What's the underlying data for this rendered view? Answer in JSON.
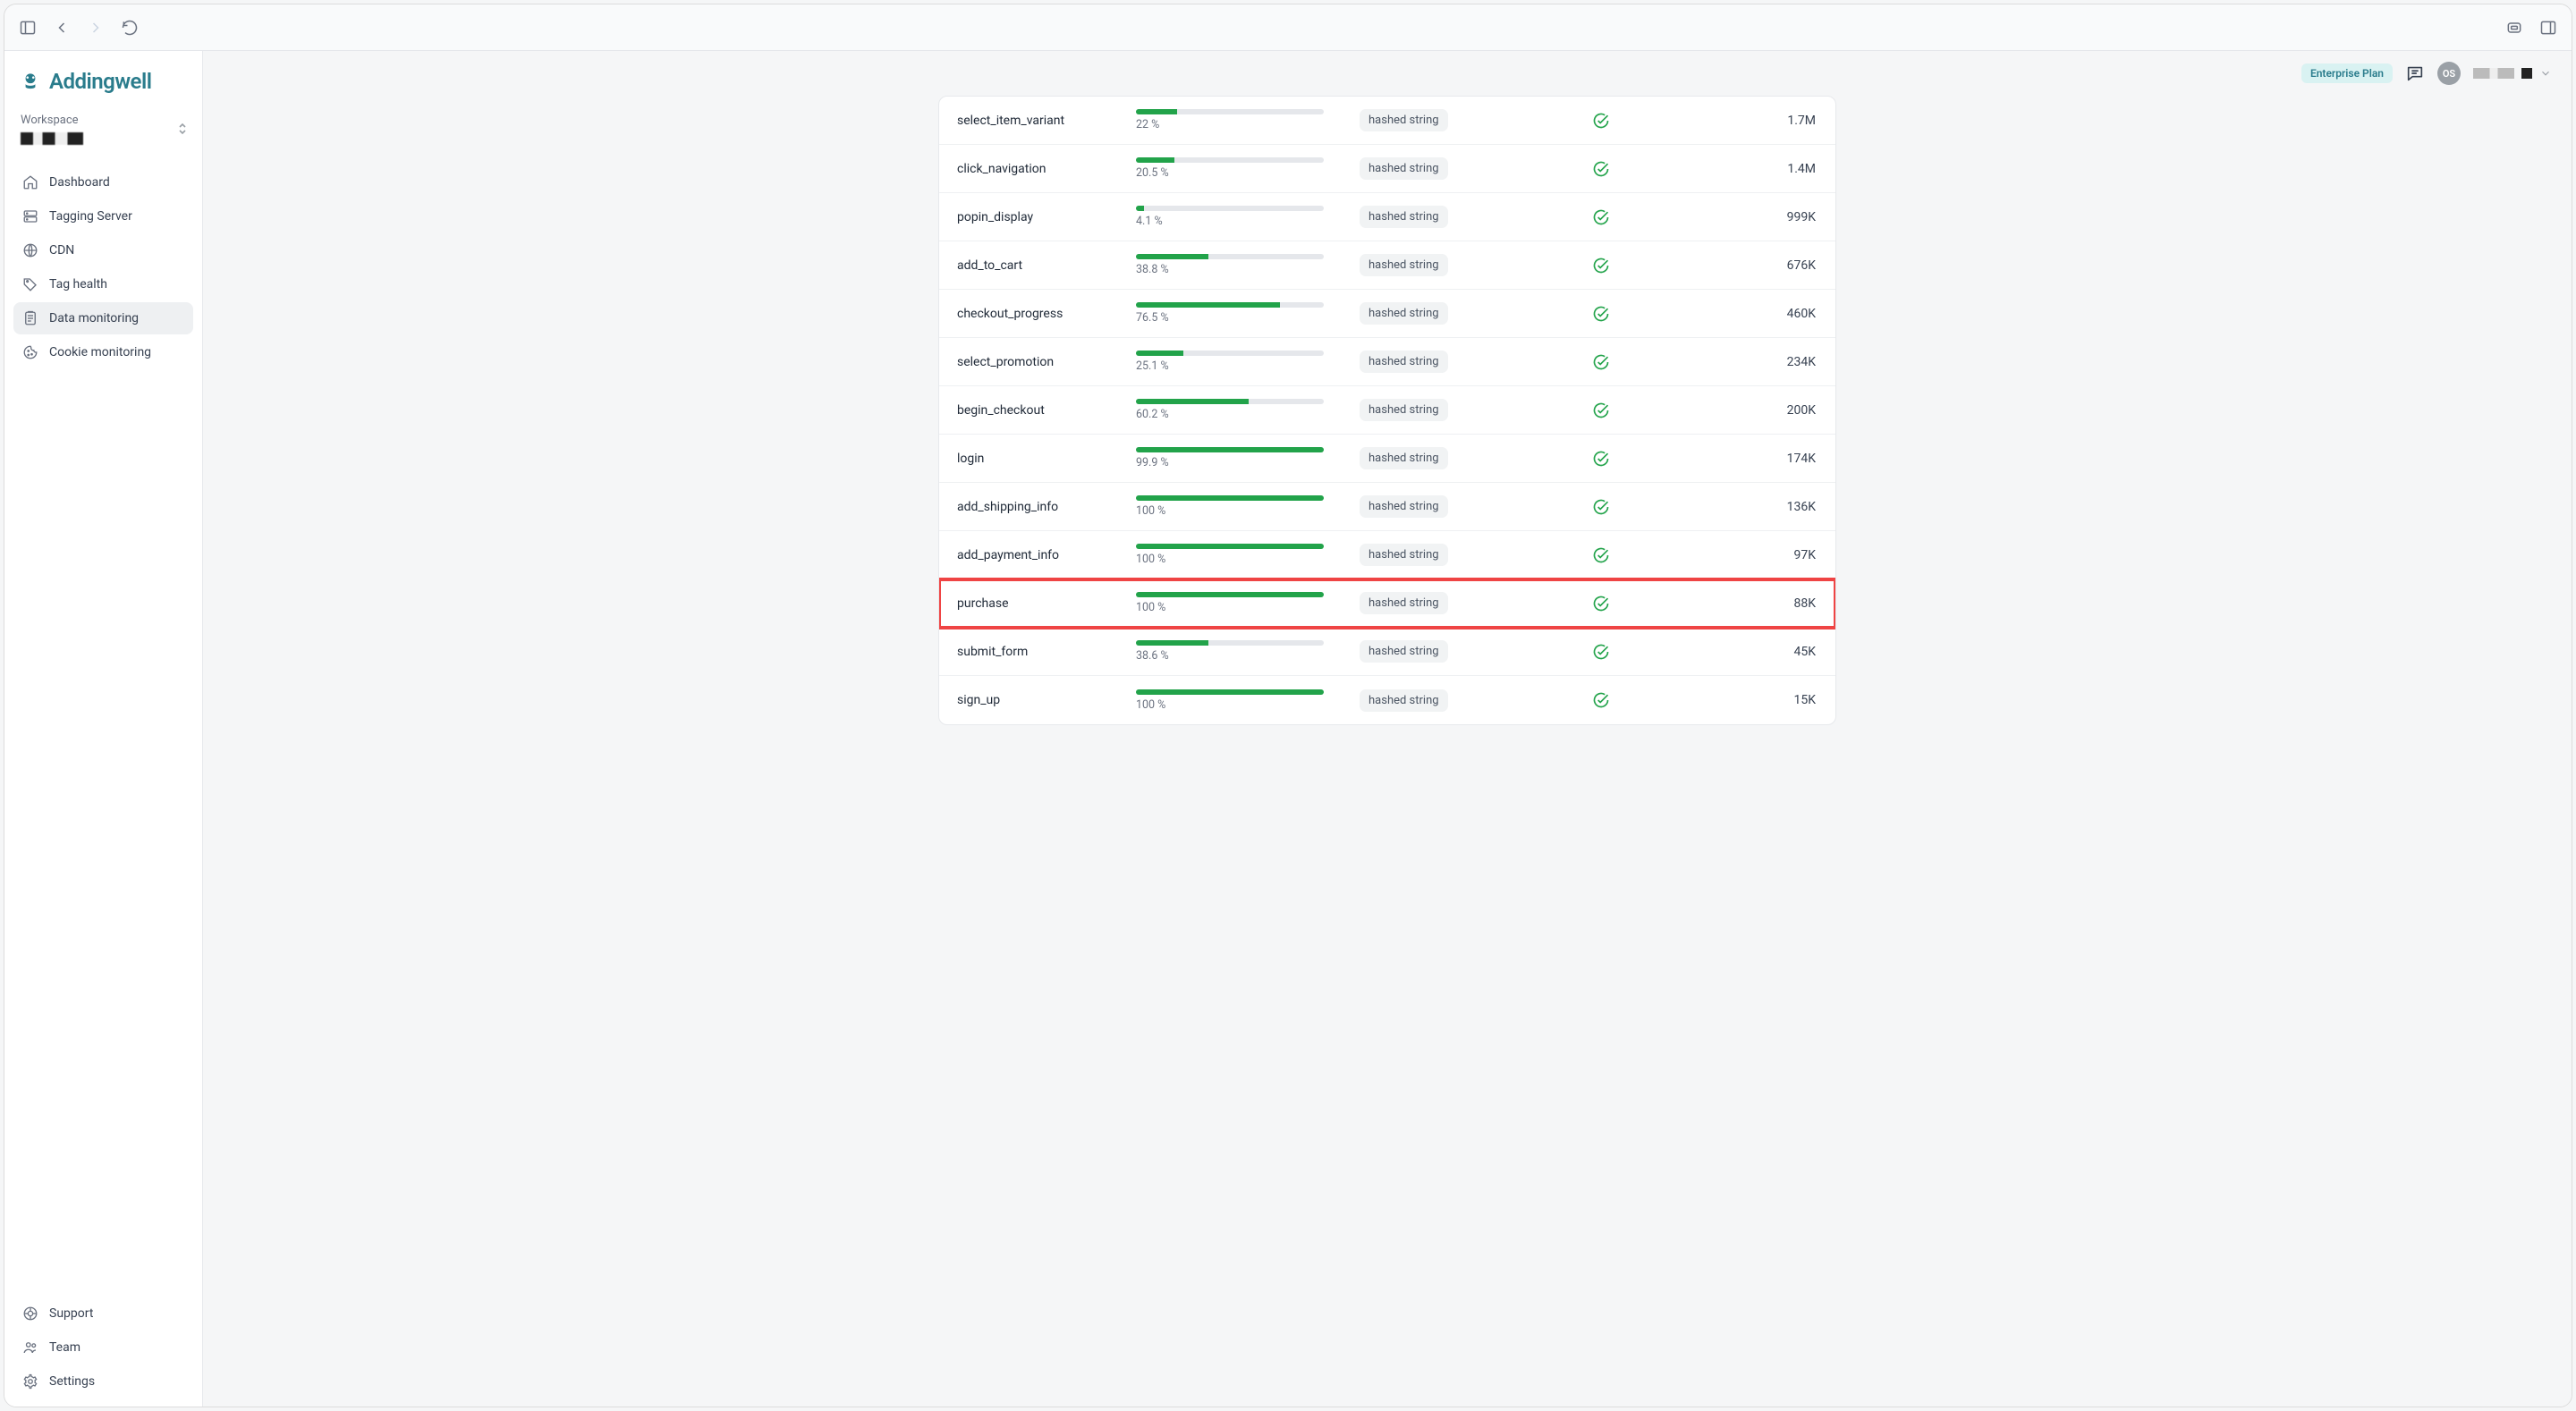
{
  "brand": {
    "name": "Addingwell"
  },
  "workspace": {
    "label": "Workspace"
  },
  "topbar": {
    "plan": "Enterprise Plan",
    "avatar": "OS"
  },
  "sidebar": {
    "items": [
      {
        "key": "dashboard",
        "label": "Dashboard"
      },
      {
        "key": "tagging-server",
        "label": "Tagging Server"
      },
      {
        "key": "cdn",
        "label": "CDN"
      },
      {
        "key": "tag-health",
        "label": "Tag health"
      },
      {
        "key": "data-monitoring",
        "label": "Data monitoring",
        "active": true
      },
      {
        "key": "cookie-monitoring",
        "label": "Cookie monitoring"
      }
    ],
    "footer": [
      {
        "key": "support",
        "label": "Support"
      },
      {
        "key": "team",
        "label": "Team"
      },
      {
        "key": "settings",
        "label": "Settings"
      }
    ]
  },
  "rows": [
    {
      "event": "select_item_variant",
      "percent": 22,
      "percent_label": "22 %",
      "type": "hashed string",
      "status": "ok",
      "count": "1.7M"
    },
    {
      "event": "click_navigation",
      "percent": 20.5,
      "percent_label": "20.5 %",
      "type": "hashed string",
      "status": "ok",
      "count": "1.4M"
    },
    {
      "event": "popin_display",
      "percent": 4.1,
      "percent_label": "4.1 %",
      "type": "hashed string",
      "status": "ok",
      "count": "999K"
    },
    {
      "event": "add_to_cart",
      "percent": 38.8,
      "percent_label": "38.8 %",
      "type": "hashed string",
      "status": "ok",
      "count": "676K"
    },
    {
      "event": "checkout_progress",
      "percent": 76.5,
      "percent_label": "76.5 %",
      "type": "hashed string",
      "status": "ok",
      "count": "460K"
    },
    {
      "event": "select_promotion",
      "percent": 25.1,
      "percent_label": "25.1 %",
      "type": "hashed string",
      "status": "ok",
      "count": "234K"
    },
    {
      "event": "begin_checkout",
      "percent": 60.2,
      "percent_label": "60.2 %",
      "type": "hashed string",
      "status": "ok",
      "count": "200K"
    },
    {
      "event": "login",
      "percent": 99.9,
      "percent_label": "99.9 %",
      "type": "hashed string",
      "status": "ok",
      "count": "174K"
    },
    {
      "event": "add_shipping_info",
      "percent": 100,
      "percent_label": "100 %",
      "type": "hashed string",
      "status": "ok",
      "count": "136K"
    },
    {
      "event": "add_payment_info",
      "percent": 100,
      "percent_label": "100 %",
      "type": "hashed string",
      "status": "ok",
      "count": "97K"
    },
    {
      "event": "purchase",
      "percent": 100,
      "percent_label": "100 %",
      "type": "hashed string",
      "status": "ok",
      "count": "88K",
      "highlight": true
    },
    {
      "event": "submit_form",
      "percent": 38.6,
      "percent_label": "38.6 %",
      "type": "hashed string",
      "status": "ok",
      "count": "45K"
    },
    {
      "event": "sign_up",
      "percent": 100,
      "percent_label": "100 %",
      "type": "hashed string",
      "status": "ok",
      "count": "15K"
    }
  ]
}
